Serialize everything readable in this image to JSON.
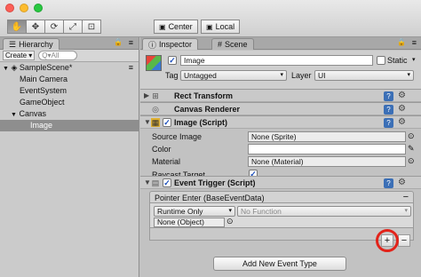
{
  "toolbar": {
    "tools": [
      {
        "icon": "hand-tool-icon",
        "glyph": "✋",
        "active": true
      },
      {
        "icon": "move-tool-icon",
        "glyph": "✥",
        "active": false
      },
      {
        "icon": "rotate-tool-icon",
        "glyph": "⟳",
        "active": false
      },
      {
        "icon": "scale-tool-icon",
        "glyph": "⤢",
        "active": false
      },
      {
        "icon": "rect-tool-icon",
        "glyph": "⊡",
        "active": false
      }
    ],
    "pivot_label": "Center",
    "space_label": "Local"
  },
  "hierarchy": {
    "tab_label": "Hierarchy",
    "create_label": "Create ▾",
    "search_placeholder": "Q▾All",
    "scene_name": "SampleScene*",
    "items": [
      "Main Camera",
      "EventSystem",
      "GameObject",
      "Canvas",
      "Image"
    ],
    "selected_item": "Image"
  },
  "inspector": {
    "tab_label": "Inspector",
    "scene_tab_label": "Scene",
    "object_name": "Image",
    "static_label": "Static",
    "tag_label": "Tag",
    "tag_value": "Untagged",
    "layer_label": "Layer",
    "layer_value": "UI",
    "components": {
      "rect_transform": "Rect Transform",
      "canvas_renderer": "Canvas Renderer",
      "image_script": "Image (Script)",
      "event_trigger": "Event Trigger (Script)"
    },
    "image_props": {
      "source_image_label": "Source Image",
      "source_image_value": "None (Sprite)",
      "color_label": "Color",
      "material_label": "Material",
      "material_value": "None (Material)",
      "raycast_label": "Raycast Target"
    },
    "event": {
      "entry_label": "Pointer Enter (BaseEventData)",
      "runtime_value": "Runtime Only",
      "function_value": "No Function",
      "object_value": "None (Object)",
      "add_button_label": "Add New Event Type",
      "plus_label": "+",
      "minus_label": "−"
    }
  },
  "colors": {
    "highlight_circle": "#e2231a",
    "selection": "#8e8e8e",
    "help_icon": "#3b6fb6"
  }
}
